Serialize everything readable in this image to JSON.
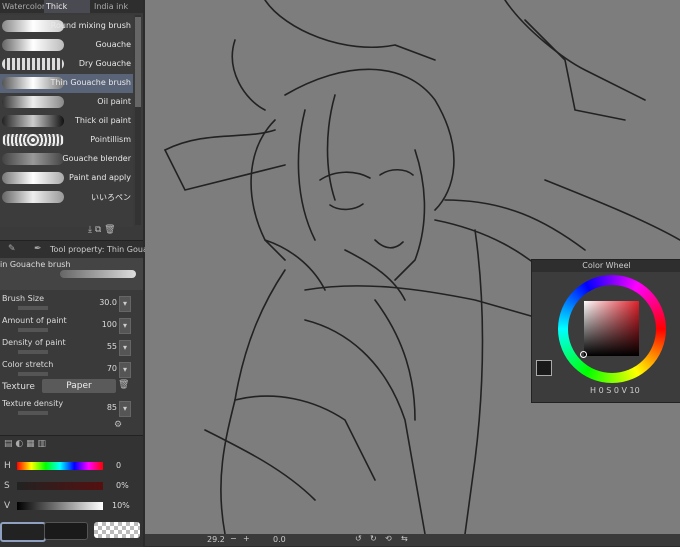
{
  "tabs": [
    "Watercolor",
    "Thick",
    "India ink"
  ],
  "brushes": [
    {
      "label": "Round mixing brush",
      "selected": false
    },
    {
      "label": "Gouache",
      "selected": false
    },
    {
      "label": "Dry Gouache",
      "selected": false
    },
    {
      "label": "Thin Gouache brush",
      "selected": true
    },
    {
      "label": "Oil paint",
      "selected": false
    },
    {
      "label": "Thick oil paint",
      "selected": false
    },
    {
      "label": "Pointillism",
      "selected": false
    },
    {
      "label": "Gouache blender",
      "selected": false
    },
    {
      "label": "Paint and apply",
      "selected": false
    },
    {
      "label": "いいろペン",
      "selected": false
    }
  ],
  "tool_property": {
    "header": "Tool property: Thin Gouache",
    "brush_name": "in Gouache brush",
    "params": [
      {
        "label": "Brush Size",
        "value": "30.0"
      },
      {
        "label": "Amount of paint",
        "value": "100"
      },
      {
        "label": "Density of paint",
        "value": "55"
      },
      {
        "label": "Color stretch",
        "value": "70"
      }
    ],
    "texture_label": "Texture",
    "texture_button": "Paper",
    "texture_density_label": "Texture density",
    "texture_density_value": "85"
  },
  "color_sliders": {
    "h_label": "H",
    "h_value": "0",
    "s_label": "S",
    "s_value": "0%",
    "v_label": "V",
    "v_value": "10%"
  },
  "color_wheel": {
    "title": "Color Wheel",
    "h_label": "H",
    "h_value": "0",
    "s_label": "S",
    "s_value": "0",
    "v_label": "V",
    "v_value": "10"
  },
  "status": {
    "zoom": "29.2",
    "angle": "0.0"
  },
  "colors": {
    "canvas": "#7d7d7d",
    "selected_brush": "#5a6478"
  }
}
